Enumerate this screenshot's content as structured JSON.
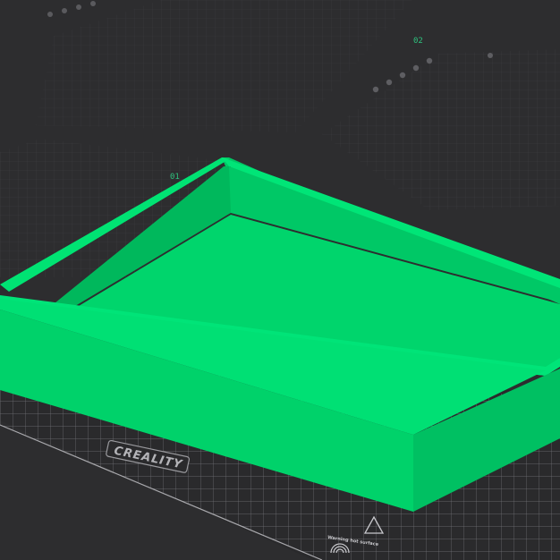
{
  "scene": {
    "plates": [
      {
        "label": "02"
      },
      {
        "label": "01"
      }
    ],
    "bed_brand": "CREALITY",
    "bed_warning": "Warning hot surface",
    "colors": {
      "background": "#2d2d2f",
      "plate_grid": "#4a4a4e",
      "bed": "#2a2a2c",
      "bed_grid": "#8a8a8e",
      "model": "#00d26a",
      "label": "#2ec27e"
    },
    "icons": [
      "fingerprint-icon",
      "warning-triangle-icon"
    ]
  }
}
